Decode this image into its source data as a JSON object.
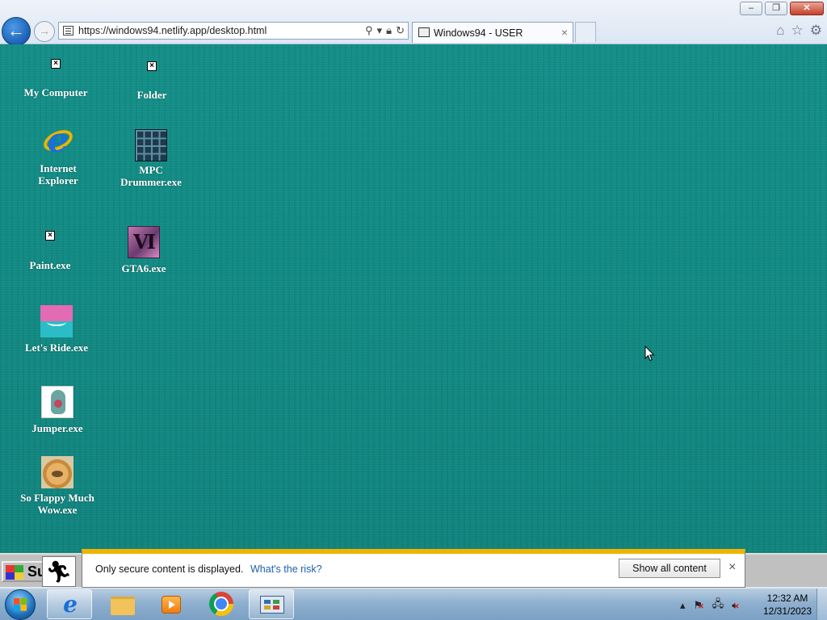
{
  "browser": {
    "url": "https://windows94.netlify.app/desktop.html",
    "tab_title": "Windows94 - USER",
    "tab_close": "×",
    "back_icon": "arrow-left-icon",
    "forward_icon": "arrow-right-icon",
    "window_controls": {
      "minimize": "‒",
      "restore": "❐",
      "close": "✕"
    },
    "toolbar_icons": [
      "home-icon",
      "star-icon",
      "gear-icon"
    ]
  },
  "desktop": {
    "background_color": "#128c86",
    "icons": [
      {
        "label": "My Computer",
        "image": "broken-image-icon"
      },
      {
        "label": "Folder",
        "image": "broken-image-icon"
      },
      {
        "label": "Internet Explorer",
        "image": "internet-explorer-icon"
      },
      {
        "label": "MPC Drummer.exe",
        "image": "drum-pad-grid-icon"
      },
      {
        "label": "Paint.exe",
        "image": "broken-image-icon"
      },
      {
        "label": "GTA6.exe",
        "image": "gta-vi-logo-icon"
      },
      {
        "label": "Let's Ride.exe",
        "image": "lets-ride-icon"
      },
      {
        "label": "Jumper.exe",
        "image": "jumper-character-icon"
      },
      {
        "label": "So Flappy Much Wow.exe",
        "image": "doge-icon"
      }
    ]
  },
  "w94_taskbar": {
    "start_label": "Su",
    "running_icon": "running-man-icon"
  },
  "notification": {
    "message": "Only secure content is displayed.",
    "link": "What's the risk?",
    "button": "Show all content",
    "close": "×",
    "accent_color": "#f0b400"
  },
  "taskbar": {
    "pinned": [
      "internet-explorer-icon",
      "folder-icon",
      "media-player-icon",
      "chrome-icon",
      "control-panel-icon"
    ],
    "tray_icons": [
      "show-hidden-icons-arrow",
      "action-center-flag-icon",
      "network-icon",
      "volume-muted-icon"
    ],
    "time": "12:32 AM",
    "date": "12/31/2023"
  }
}
